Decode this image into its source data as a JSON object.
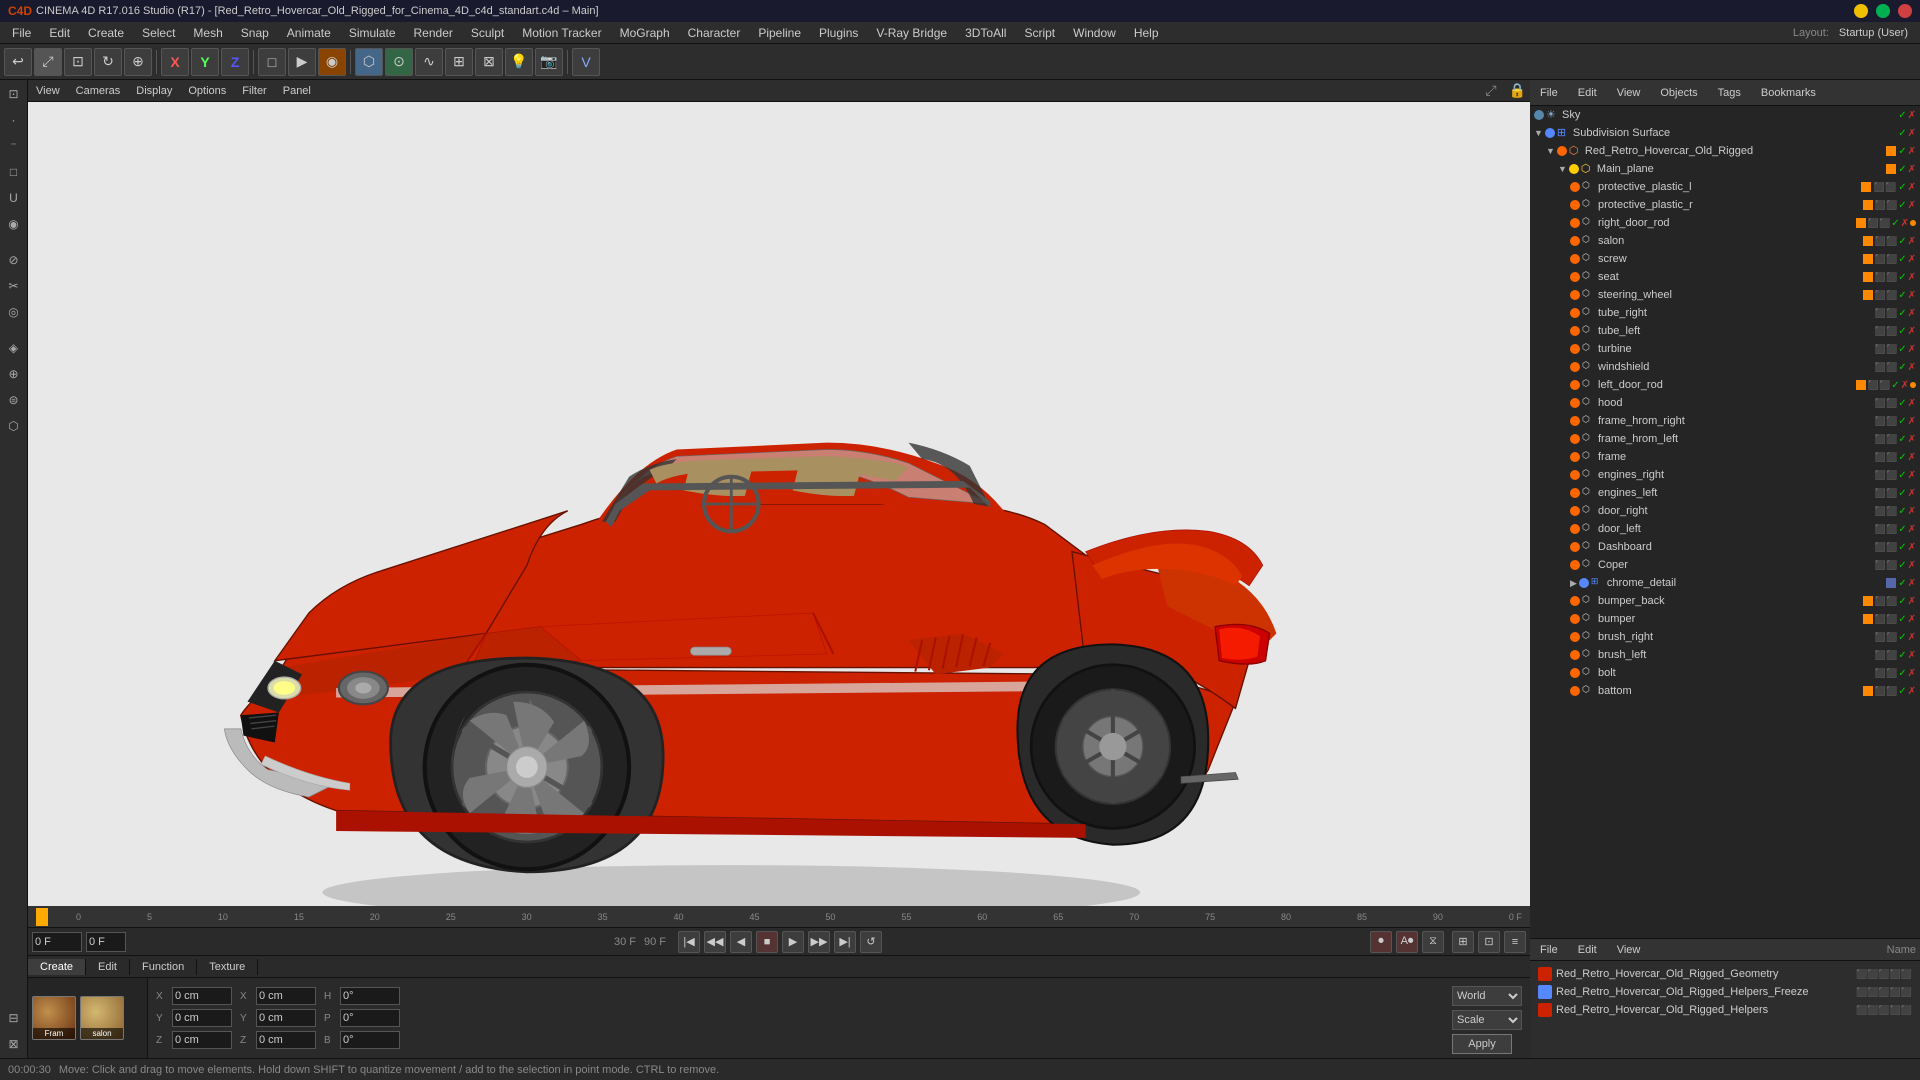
{
  "titlebar": {
    "title": "CINEMA 4D R17.016 Studio (R17) - [Red_Retro_Hovercar_Old_Rigged_for_Cinema_4D_c4d_standart.c4d – Main]",
    "buttons": [
      "minimize",
      "maximize",
      "close"
    ]
  },
  "menubar": {
    "items": [
      "File",
      "Edit",
      "Create",
      "Select",
      "Mesh",
      "Snap",
      "Animate",
      "Simulate",
      "Render",
      "Sculpt",
      "Motion Tracker",
      "MoGraph",
      "Character",
      "Pipeline",
      "Plugins",
      "V-Ray Bridge",
      "3DToAll",
      "Script",
      "Window",
      "Help"
    ]
  },
  "right_panel_header": {
    "label": "Layout:",
    "layout_value": "Startup (User)",
    "buttons": [
      "File",
      "Edit",
      "View",
      "Objects",
      "Tags",
      "Bookmarks"
    ]
  },
  "object_list": {
    "items": [
      {
        "id": "sky",
        "name": "Sky",
        "indent": 0,
        "color": "#5588aa",
        "has_arrow": false
      },
      {
        "id": "subdivision_surface",
        "name": "Subdivision Surface",
        "indent": 0,
        "color": "#5588ff",
        "has_arrow": true,
        "expanded": true
      },
      {
        "id": "red_retro",
        "name": "Red_Retro_Hovercar_Old_Rigged",
        "indent": 1,
        "color": "#ff6600",
        "has_arrow": true,
        "expanded": true
      },
      {
        "id": "main_plane",
        "name": "Main_plane",
        "indent": 2,
        "color": "#ffcc00",
        "has_arrow": true,
        "expanded": true
      },
      {
        "id": "protective_plastic_l",
        "name": "protective_plastic_l",
        "indent": 3,
        "color": "#ff6600"
      },
      {
        "id": "protective_plastic_r",
        "name": "protective_plastic_r",
        "indent": 3,
        "color": "#ff6600"
      },
      {
        "id": "right_door_rod",
        "name": "right_door_rod",
        "indent": 3,
        "color": "#ff6600"
      },
      {
        "id": "salon",
        "name": "salon",
        "indent": 3,
        "color": "#ff6600"
      },
      {
        "id": "screw",
        "name": "screw",
        "indent": 3,
        "color": "#ff6600"
      },
      {
        "id": "seat",
        "name": "seat",
        "indent": 3,
        "color": "#ff6600"
      },
      {
        "id": "steering_wheel",
        "name": "steering_wheel",
        "indent": 3,
        "color": "#ff6600"
      },
      {
        "id": "tube_right",
        "name": "tube_right",
        "indent": 3,
        "color": "#ff6600"
      },
      {
        "id": "tube_left",
        "name": "tube_left",
        "indent": 3,
        "color": "#ff6600"
      },
      {
        "id": "turbine",
        "name": "turbine",
        "indent": 3,
        "color": "#ff6600"
      },
      {
        "id": "windshield",
        "name": "windshield",
        "indent": 3,
        "color": "#ff6600"
      },
      {
        "id": "left_door_rod",
        "name": "left_door_rod",
        "indent": 3,
        "color": "#ff6600"
      },
      {
        "id": "hood",
        "name": "hood",
        "indent": 3,
        "color": "#ff6600"
      },
      {
        "id": "frame_hrom_right",
        "name": "frame_hrom_right",
        "indent": 3,
        "color": "#ff6600"
      },
      {
        "id": "frame_hrom_left",
        "name": "frame_hrom_left",
        "indent": 3,
        "color": "#ff6600"
      },
      {
        "id": "frame",
        "name": "frame",
        "indent": 3,
        "color": "#ff6600"
      },
      {
        "id": "engines_right",
        "name": "engines_right",
        "indent": 3,
        "color": "#ff6600"
      },
      {
        "id": "engines_left",
        "name": "engines_left",
        "indent": 3,
        "color": "#ff6600"
      },
      {
        "id": "door_right",
        "name": "door_right",
        "indent": 3,
        "color": "#ff6600"
      },
      {
        "id": "door_left",
        "name": "door_left",
        "indent": 3,
        "color": "#ff6600"
      },
      {
        "id": "Dashboard",
        "name": "Dashboard",
        "indent": 3,
        "color": "#ff6600"
      },
      {
        "id": "Coper",
        "name": "Coper",
        "indent": 3,
        "color": "#ff6600"
      },
      {
        "id": "chrome_detail",
        "name": "chrome_detail",
        "indent": 3,
        "color": "#5588ff"
      },
      {
        "id": "bumper_back",
        "name": "bumper_back",
        "indent": 3,
        "color": "#ff6600"
      },
      {
        "id": "bumper",
        "name": "bumper",
        "indent": 3,
        "color": "#ff6600"
      },
      {
        "id": "brush_right",
        "name": "brush_right",
        "indent": 3,
        "color": "#ff6600"
      },
      {
        "id": "brush_left",
        "name": "brush_left",
        "indent": 3,
        "color": "#ff6600"
      },
      {
        "id": "bolt",
        "name": "bolt",
        "indent": 3,
        "color": "#ff6600"
      },
      {
        "id": "battom",
        "name": "battom",
        "indent": 3,
        "color": "#ff6600"
      }
    ]
  },
  "lower_panel": {
    "header_buttons": [
      "File",
      "Edit",
      "View"
    ],
    "column_header": "Name",
    "rows": [
      {
        "name": "Red_Retro_Hovercar_Old_Rigged_Geometry",
        "color": "#cc2200"
      },
      {
        "name": "Red_Retro_Hovercar_Old_Rigged_Helpers_Freeze",
        "color": "#5588ff"
      },
      {
        "name": "Red_Retro_Hovercar_Old_Rigged_Helpers",
        "color": "#cc2200"
      }
    ]
  },
  "timeline": {
    "markers": [
      "0",
      "5",
      "10",
      "15",
      "20",
      "25",
      "30",
      "35",
      "40",
      "45",
      "50",
      "55",
      "60",
      "65",
      "70",
      "75",
      "80",
      "85",
      "90"
    ],
    "current_frame": "0",
    "start_frame": "0F",
    "end_frame": "0F",
    "fps": "30 F",
    "total_frames": "90 F"
  },
  "material_tabs": {
    "tabs": [
      "Create",
      "Edit",
      "Function",
      "Texture"
    ]
  },
  "materials": [
    {
      "name": "Fram",
      "color": "#8a6040"
    },
    {
      "name": "salon",
      "color": "#c0a060"
    }
  ],
  "coordinates": {
    "x_label": "X",
    "x_value": "0 cm",
    "x2_label": "X",
    "x2_value": "0 cm",
    "h_label": "H",
    "h_value": "0°",
    "y_label": "Y",
    "y_value": "0 cm",
    "y2_label": "Y",
    "y2_value": "0 cm",
    "p_label": "P",
    "p_value": "0°",
    "z_label": "Z",
    "z_value": "0 cm",
    "z2_label": "Z",
    "z2_value": "0 cm",
    "b_label": "B",
    "b_value": "0°",
    "mode_world": "World",
    "mode_scale": "Scale",
    "apply_label": "Apply"
  },
  "status_bar": {
    "time": "00:00:30",
    "message": "Move: Click and drag to move elements. Hold down SHIFT to quantize movement / add to the selection in point mode. CTRL to remove."
  },
  "viewport_tabs": {
    "items": [
      "View",
      "Cameras",
      "Display",
      "Options",
      "Filter",
      "Panel"
    ]
  }
}
